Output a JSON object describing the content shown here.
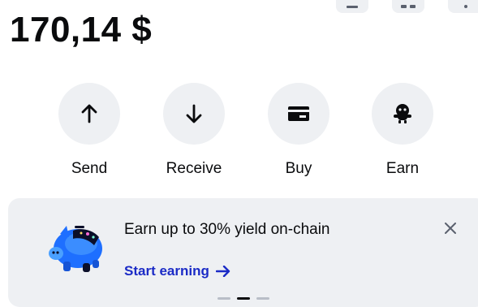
{
  "wallet": {
    "balance": "170,14 $"
  },
  "header": {
    "icons": [
      "list-icon",
      "grid-icon",
      "more-icon"
    ]
  },
  "actions": [
    {
      "label": "Send",
      "icon": "arrow-up-icon"
    },
    {
      "label": "Receive",
      "icon": "arrow-down-icon"
    },
    {
      "label": "Buy",
      "icon": "card-icon"
    },
    {
      "label": "Earn",
      "icon": "piggy-icon"
    }
  ],
  "promo": {
    "headline": "Earn up to 30% yield on-chain",
    "cta_label": "Start earning",
    "cta_icon": "arrow-right-icon",
    "close_icon": "close-icon",
    "art": "piggy-bank-illustration",
    "pager_count": 3,
    "pager_active": 2
  },
  "colors": {
    "accent": "#1b2bc6",
    "surface": "#eef0f3",
    "text": "#0a0b0d"
  }
}
